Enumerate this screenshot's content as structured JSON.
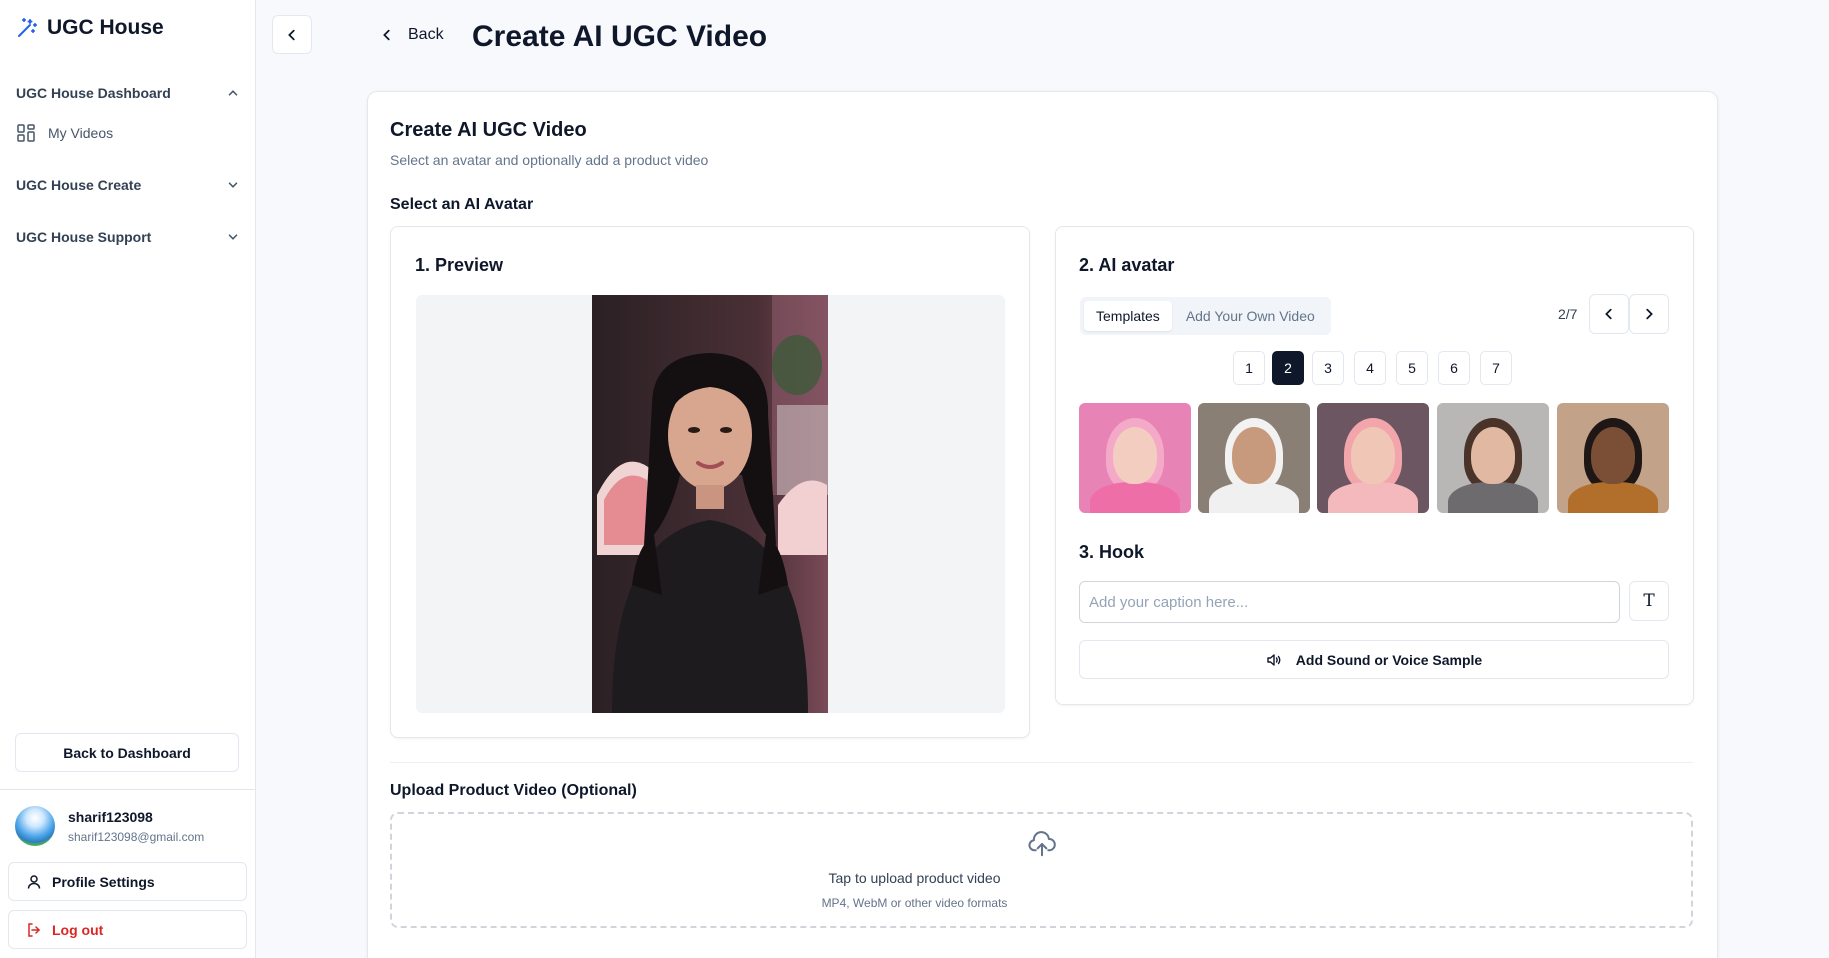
{
  "brand": {
    "name": "UGC House"
  },
  "sidebar": {
    "groups": [
      {
        "label": "UGC House Dashboard",
        "expanded": true,
        "items": [
          {
            "label": "My Videos",
            "icon": "grid-icon"
          }
        ]
      },
      {
        "label": "UGC House Create",
        "expanded": false
      },
      {
        "label": "UGC House Support",
        "expanded": false
      }
    ],
    "back_to_dashboard": "Back to Dashboard",
    "user": {
      "name": "sharif123098",
      "email": "sharif123098@gmail.com"
    },
    "profile_settings": "Profile Settings",
    "logout": "Log out"
  },
  "header": {
    "back": "Back",
    "title": "Create AI UGC Video"
  },
  "card": {
    "title": "Create AI UGC Video",
    "subtitle": "Select an avatar and optionally add a product video",
    "select_label": "Select an AI Avatar"
  },
  "preview": {
    "title": "1. Preview"
  },
  "avatar": {
    "title": "2. AI avatar",
    "tabs": [
      "Templates",
      "Add Your Own Video"
    ],
    "active_tab": 0,
    "page_indicator": "2/7",
    "pages": [
      "1",
      "2",
      "3",
      "4",
      "5",
      "6",
      "7"
    ],
    "current_page": 2,
    "thumbnails": [
      {
        "bg": "#e884b5",
        "face": "#f3cdbf",
        "hair": "#f4a9c8",
        "body": "#ee6ea7"
      },
      {
        "bg": "#8a7f74",
        "face": "#c79a7d",
        "hair": "#f2f2f2",
        "body": "#f0f0f0"
      },
      {
        "bg": "#6c5661",
        "face": "#f0c7b7",
        "hair": "#f2a6ab",
        "body": "#f4b9bc"
      },
      {
        "bg": "#b9b6b6",
        "face": "#e1b8a1",
        "hair": "#4a3328",
        "body": "#6e6b6e"
      },
      {
        "bg": "#c2a38a",
        "face": "#7a4f35",
        "hair": "#1f1715",
        "body": "#b26f2c"
      }
    ]
  },
  "hook": {
    "title": "3. Hook",
    "placeholder": "Add your caption here...",
    "text_icon": "T",
    "sound_button": "Add Sound or Voice Sample"
  },
  "upload": {
    "label": "Upload Product Video (Optional)",
    "title": "Tap to upload product video",
    "hint": "MP4, WebM or other video formats"
  }
}
